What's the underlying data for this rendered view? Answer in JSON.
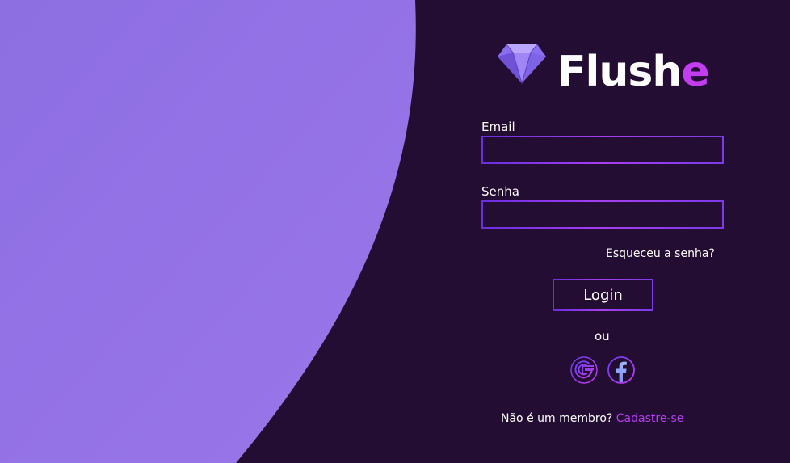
{
  "brand": {
    "name_main": "Flush",
    "name_accent": "e"
  },
  "form": {
    "email_label": "Email",
    "email_value": "",
    "password_label": "Senha",
    "password_value": "",
    "forgot_password": "Esqueceu a senha?",
    "login_label": "Login",
    "or_label": "ou"
  },
  "social": {
    "google_icon": "google-icon",
    "facebook_icon": "facebook-icon"
  },
  "signup": {
    "prompt": "Não é um membro?",
    "link": "Cadastre-se"
  },
  "colors": {
    "background": "#230d32",
    "panel": "#9373e6",
    "accent": "#b33ef2",
    "border_gradient_start": "#6a2ee0",
    "border_gradient_end": "#a63ff0"
  }
}
